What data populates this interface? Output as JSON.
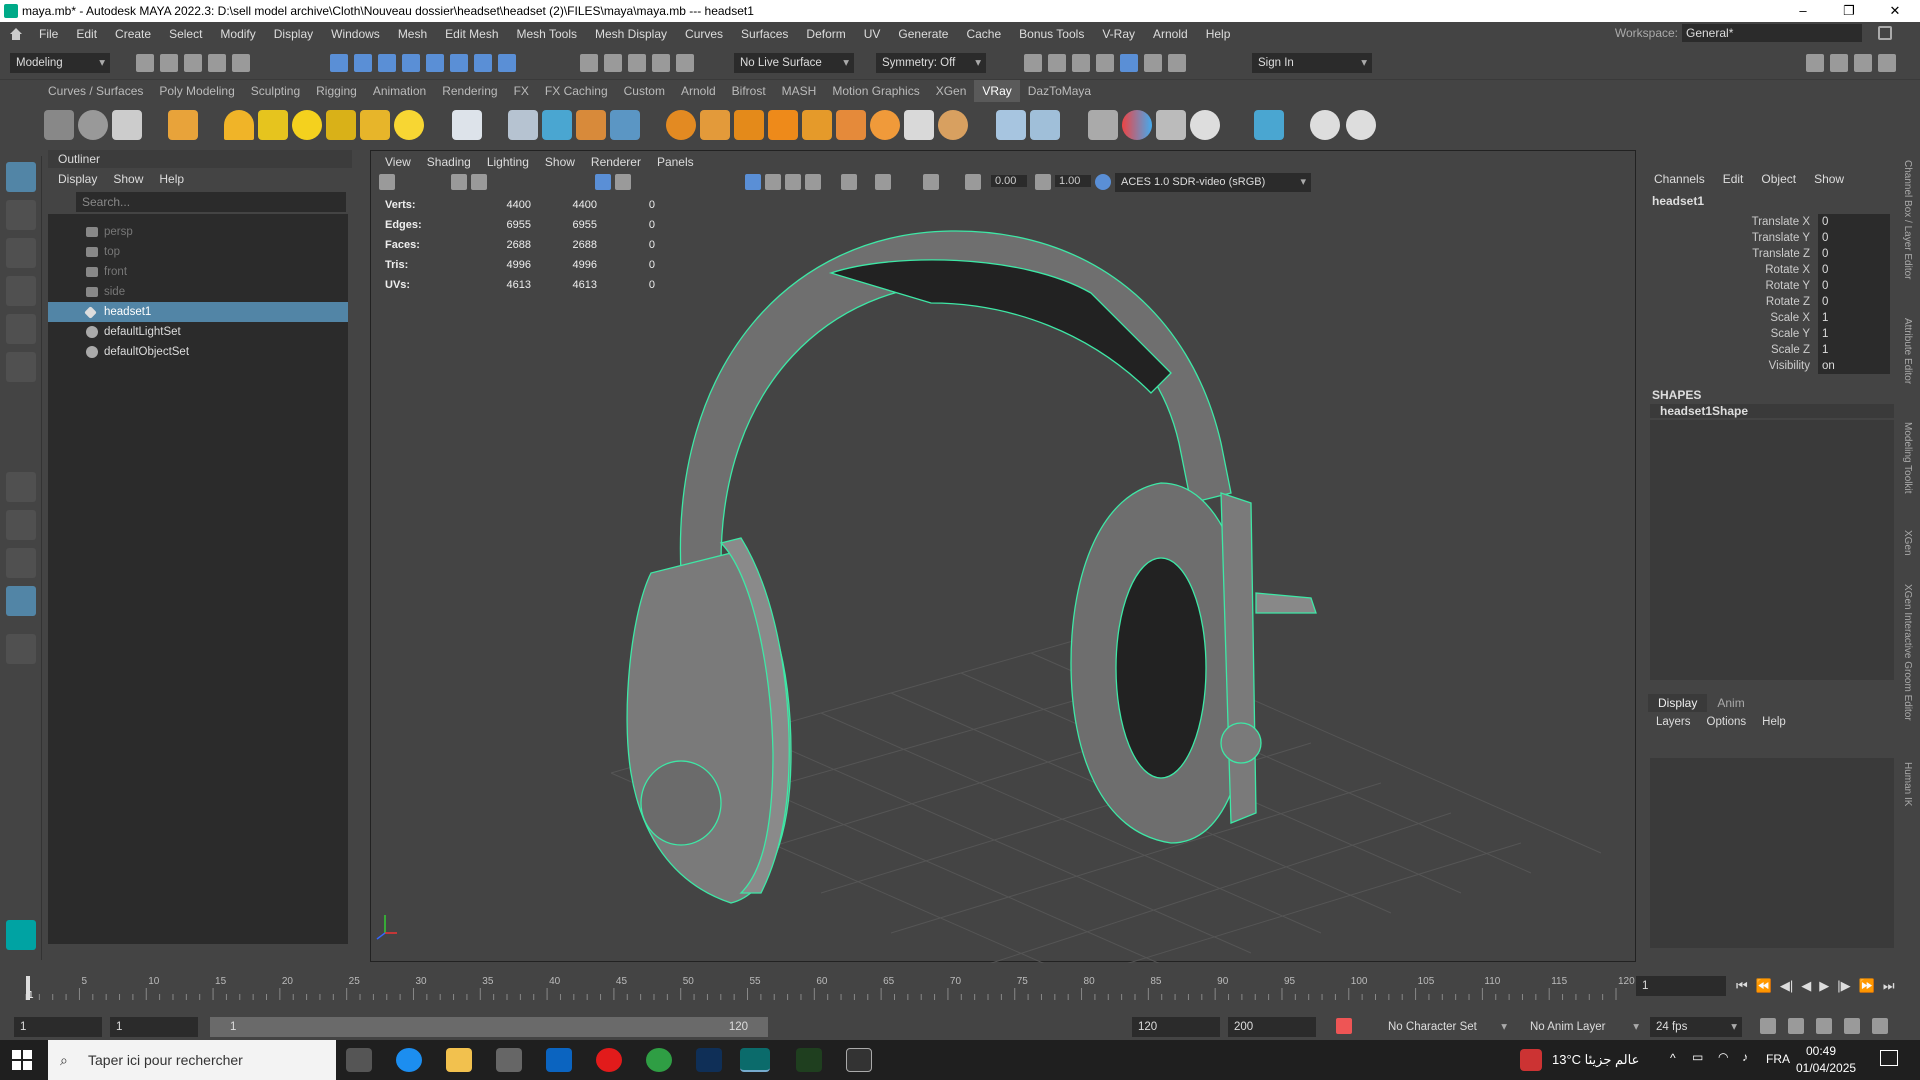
{
  "title_bar": {
    "text": "maya.mb* - Autodesk MAYA 2022.3: D:\\sell model archive\\Cloth\\Nouveau dossier\\headset\\headset (2)\\FILES\\maya\\maya.mb   ---   headset1",
    "min": "–",
    "max": "❐",
    "close": "✕"
  },
  "menu": [
    "File",
    "Edit",
    "Create",
    "Select",
    "Modify",
    "Display",
    "Windows",
    "Mesh",
    "Edit Mesh",
    "Mesh Tools",
    "Mesh Display",
    "Curves",
    "Surfaces",
    "Deform",
    "UV",
    "Generate",
    "Cache",
    "Bonus Tools",
    "V-Ray",
    "Arnold",
    "Help"
  ],
  "workspace": {
    "label": "Workspace:",
    "value": "General*"
  },
  "status": {
    "mode": "Modeling",
    "live_surface": "No Live Surface",
    "symmetry": "Symmetry: Off",
    "sign_in": "Sign In"
  },
  "shelf_tabs": [
    "Curves / Surfaces",
    "Poly Modeling",
    "Sculpting",
    "Rigging",
    "Animation",
    "Rendering",
    "FX",
    "FX Caching",
    "Custom",
    "Arnold",
    "Bifrost",
    "MASH",
    "Motion Graphics",
    "XGen",
    "VRay",
    "DazToMaya"
  ],
  "shelf_active": "VRay",
  "outliner": {
    "title": "Outliner",
    "menu": [
      "Display",
      "Show",
      "Help"
    ],
    "search_placeholder": "Search...",
    "items": [
      {
        "label": "persp"
      },
      {
        "label": "top"
      },
      {
        "label": "front"
      },
      {
        "label": "side"
      },
      {
        "label": "headset1"
      },
      {
        "label": "defaultLightSet"
      },
      {
        "label": "defaultObjectSet"
      }
    ]
  },
  "viewport": {
    "menu": [
      "View",
      "Shading",
      "Lighting",
      "Show",
      "Renderer",
      "Panels"
    ],
    "exposure": "0.00",
    "gamma": "1.00",
    "color_space": "ACES 1.0 SDR-video (sRGB)",
    "hud": [
      {
        "k": "Verts:",
        "a": "4400",
        "b": "4400",
        "c": "0"
      },
      {
        "k": "Edges:",
        "a": "6955",
        "b": "6955",
        "c": "0"
      },
      {
        "k": "Faces:",
        "a": "2688",
        "b": "2688",
        "c": "0"
      },
      {
        "k": "Tris:",
        "a": "4996",
        "b": "4996",
        "c": "0"
      },
      {
        "k": "UVs:",
        "a": "4613",
        "b": "4613",
        "c": "0"
      }
    ]
  },
  "channel_box": {
    "menu": [
      "Channels",
      "Edit",
      "Object",
      "Show"
    ],
    "object": "headset1",
    "attrs": [
      {
        "n": "Translate X",
        "v": "0"
      },
      {
        "n": "Translate Y",
        "v": "0"
      },
      {
        "n": "Translate Z",
        "v": "0"
      },
      {
        "n": "Rotate X",
        "v": "0"
      },
      {
        "n": "Rotate Y",
        "v": "0"
      },
      {
        "n": "Rotate Z",
        "v": "0"
      },
      {
        "n": "Scale X",
        "v": "1"
      },
      {
        "n": "Scale Y",
        "v": "1"
      },
      {
        "n": "Scale Z",
        "v": "1"
      },
      {
        "n": "Visibility",
        "v": "on"
      }
    ],
    "shapes_label": "SHAPES",
    "shape": "headset1Shape"
  },
  "layers": {
    "tabs": [
      "Display",
      "Anim"
    ],
    "menu": [
      "Layers",
      "Options",
      "Help"
    ]
  },
  "side_tabs": [
    "Channel Box / Layer Editor",
    "Attribute Editor",
    "Modeling Toolkit",
    "XGen",
    "XGen Interactive Groom Editor",
    "Human IK"
  ],
  "timeline": {
    "ticks": [
      "5",
      "10",
      "15",
      "20",
      "25",
      "30",
      "35",
      "40",
      "45",
      "50",
      "55",
      "60",
      "65",
      "70",
      "75",
      "80",
      "85",
      "90",
      "95",
      "100",
      "105",
      "110",
      "115",
      "120"
    ],
    "current": "1",
    "current_field": "1"
  },
  "range": {
    "start": "1",
    "start2": "1",
    "inner_start": "1",
    "inner_end": "120",
    "end": "120",
    "end2": "200",
    "char_set": "No Character Set",
    "anim_layer": "No Anim Layer",
    "fps": "24 fps"
  },
  "taskbar": {
    "search": "Taper ici pour rechercher",
    "weather": "13°C عالم جزيئا",
    "lang": "FRA",
    "time": "00:49",
    "date": "01/04/2025"
  }
}
